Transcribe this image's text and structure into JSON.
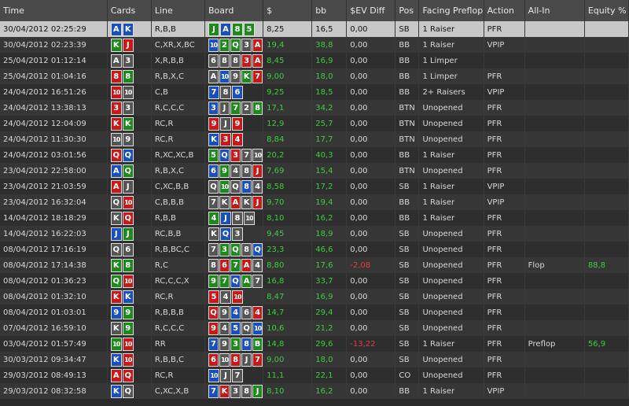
{
  "columns": [
    "Time",
    "Cards",
    "Line",
    "Board",
    "$",
    "bb",
    "$EV Diff",
    "Pos",
    "Facing Preflop",
    "Action",
    "All-In",
    "Equity %"
  ],
  "suit_colors": {
    "s": "#555555",
    "h": "#c81818",
    "d": "#1a4fbf",
    "c": "#1e8a1e"
  },
  "rows": [
    {
      "time": "30/04/2012 02:25:29",
      "cards": [
        [
          "A",
          "d"
        ],
        [
          "K",
          "d"
        ]
      ],
      "line": "R,B,B",
      "board": [
        [
          "J",
          "c"
        ],
        [
          "A",
          "d"
        ],
        [
          "8",
          "c"
        ],
        [
          "5",
          "c"
        ]
      ],
      "dollars": "8,25",
      "bb": "16,5",
      "ev": "0,00",
      "pos": "SB",
      "facing": "1 Raiser",
      "action": "PFR",
      "allin": "",
      "equity": ""
    },
    {
      "time": "30/04/2012 02:23:39",
      "cards": [
        [
          "K",
          "c"
        ],
        [
          "J",
          "h"
        ]
      ],
      "line": "C,XR,X,BC",
      "board": [
        [
          "10",
          "d"
        ],
        [
          "2",
          "c"
        ],
        [
          "Q",
          "c"
        ],
        [
          "3",
          "s"
        ],
        [
          "A",
          "h"
        ]
      ],
      "dollars": "19,4",
      "bb": "38,8",
      "ev": "0,00",
      "pos": "BB",
      "facing": "1 Raiser",
      "action": "VPIP",
      "allin": "",
      "equity": ""
    },
    {
      "time": "25/04/2012 01:12:14",
      "cards": [
        [
          "A",
          "s"
        ],
        [
          "3",
          "s"
        ]
      ],
      "line": "X,R,B,B",
      "board": [
        [
          "6",
          "s"
        ],
        [
          "8",
          "s"
        ],
        [
          "8",
          "s"
        ],
        [
          "3",
          "h"
        ],
        [
          "A",
          "h"
        ]
      ],
      "dollars": "8,45",
      "bb": "16,9",
      "ev": "0,00",
      "pos": "BB",
      "facing": "1 Limper",
      "action": "",
      "allin": "",
      "equity": ""
    },
    {
      "time": "25/04/2012 01:04:16",
      "cards": [
        [
          "8",
          "h"
        ],
        [
          "8",
          "c"
        ]
      ],
      "line": "R,B,X,C",
      "board": [
        [
          "A",
          "s"
        ],
        [
          "10",
          "d"
        ],
        [
          "9",
          "s"
        ],
        [
          "K",
          "c"
        ],
        [
          "7",
          "h"
        ]
      ],
      "dollars": "9,00",
      "bb": "18,0",
      "ev": "0,00",
      "pos": "BB",
      "facing": "1 Limper",
      "action": "PFR",
      "allin": "",
      "equity": ""
    },
    {
      "time": "24/04/2012 16:51:26",
      "cards": [
        [
          "10",
          "h"
        ],
        [
          "10",
          "s"
        ]
      ],
      "line": "C,B",
      "board": [
        [
          "7",
          "d"
        ],
        [
          "8",
          "s"
        ],
        [
          "6",
          "d"
        ]
      ],
      "dollars": "9,25",
      "bb": "18,5",
      "ev": "0,00",
      "pos": "BB",
      "facing": "2+ Raisers",
      "action": "VPIP",
      "allin": "",
      "equity": ""
    },
    {
      "time": "24/04/2012 13:38:13",
      "cards": [
        [
          "3",
          "h"
        ],
        [
          "3",
          "s"
        ]
      ],
      "line": "R,C,C,C",
      "board": [
        [
          "3",
          "d"
        ],
        [
          "J",
          "s"
        ],
        [
          "7",
          "c"
        ],
        [
          "2",
          "s"
        ],
        [
          "8",
          "c"
        ]
      ],
      "dollars": "17,1",
      "bb": "34,2",
      "ev": "0,00",
      "pos": "BTN",
      "facing": "Unopened",
      "action": "PFR",
      "allin": "",
      "equity": ""
    },
    {
      "time": "24/04/2012 12:04:09",
      "cards": [
        [
          "K",
          "h"
        ],
        [
          "K",
          "c"
        ]
      ],
      "line": "RC,R",
      "board": [
        [
          "9",
          "h"
        ],
        [
          "J",
          "s"
        ],
        [
          "9",
          "h"
        ]
      ],
      "dollars": "12,9",
      "bb": "25,7",
      "ev": "0,00",
      "pos": "BTN",
      "facing": "Unopened",
      "action": "PFR",
      "allin": "",
      "equity": ""
    },
    {
      "time": "24/04/2012 11:30:30",
      "cards": [
        [
          "10",
          "s"
        ],
        [
          "9",
          "s"
        ]
      ],
      "line": "RC,R",
      "board": [
        [
          "K",
          "d"
        ],
        [
          "3",
          "h"
        ],
        [
          "4",
          "h"
        ]
      ],
      "dollars": "8,84",
      "bb": "17,7",
      "ev": "0,00",
      "pos": "BTN",
      "facing": "Unopened",
      "action": "PFR",
      "allin": "",
      "equity": ""
    },
    {
      "time": "24/04/2012 03:01:56",
      "cards": [
        [
          "Q",
          "h"
        ],
        [
          "Q",
          "d"
        ]
      ],
      "line": "R,XC,XC,B",
      "board": [
        [
          "5",
          "c"
        ],
        [
          "Q",
          "d"
        ],
        [
          "3",
          "h"
        ],
        [
          "7",
          "s"
        ],
        [
          "10",
          "s"
        ]
      ],
      "dollars": "20,2",
      "bb": "40,3",
      "ev": "0,00",
      "pos": "BB",
      "facing": "1 Raiser",
      "action": "PFR",
      "allin": "",
      "equity": ""
    },
    {
      "time": "23/04/2012 22:58:00",
      "cards": [
        [
          "A",
          "d"
        ],
        [
          "Q",
          "c"
        ]
      ],
      "line": "R,B,X,C",
      "board": [
        [
          "6",
          "d"
        ],
        [
          "9",
          "c"
        ],
        [
          "4",
          "s"
        ],
        [
          "8",
          "s"
        ],
        [
          "J",
          "h"
        ]
      ],
      "dollars": "7,69",
      "bb": "15,4",
      "ev": "0,00",
      "pos": "BTN",
      "facing": "Unopened",
      "action": "PFR",
      "allin": "",
      "equity": ""
    },
    {
      "time": "23/04/2012 21:03:59",
      "cards": [
        [
          "A",
          "h"
        ],
        [
          "J",
          "s"
        ]
      ],
      "line": "C,XC,B,B",
      "board": [
        [
          "Q",
          "s"
        ],
        [
          "10",
          "c"
        ],
        [
          "Q",
          "s"
        ],
        [
          "8",
          "d"
        ],
        [
          "4",
          "s"
        ]
      ],
      "dollars": "8,58",
      "bb": "17,2",
      "ev": "0,00",
      "pos": "SB",
      "facing": "1 Raiser",
      "action": "VPIP",
      "allin": "",
      "equity": ""
    },
    {
      "time": "23/04/2012 16:32:04",
      "cards": [
        [
          "Q",
          "s"
        ],
        [
          "10",
          "h"
        ]
      ],
      "line": "C,B,B,B",
      "board": [
        [
          "7",
          "s"
        ],
        [
          "K",
          "s"
        ],
        [
          "A",
          "h"
        ],
        [
          "K",
          "s"
        ],
        [
          "J",
          "h"
        ]
      ],
      "dollars": "9,70",
      "bb": "19,4",
      "ev": "0,00",
      "pos": "BB",
      "facing": "1 Raiser",
      "action": "VPIP",
      "allin": "",
      "equity": ""
    },
    {
      "time": "14/04/2012 18:18:29",
      "cards": [
        [
          "K",
          "s"
        ],
        [
          "Q",
          "h"
        ]
      ],
      "line": "R,B,B",
      "board": [
        [
          "4",
          "c"
        ],
        [
          "J",
          "d"
        ],
        [
          "8",
          "s"
        ],
        [
          "10",
          "s"
        ]
      ],
      "dollars": "8,10",
      "bb": "16,2",
      "ev": "0,00",
      "pos": "BB",
      "facing": "1 Raiser",
      "action": "PFR",
      "allin": "",
      "equity": ""
    },
    {
      "time": "14/04/2012 16:22:03",
      "cards": [
        [
          "J",
          "d"
        ],
        [
          "J",
          "c"
        ]
      ],
      "line": "RC,B,B",
      "board": [
        [
          "K",
          "s"
        ],
        [
          "Q",
          "d"
        ],
        [
          "3",
          "s"
        ]
      ],
      "dollars": "9,45",
      "bb": "18,9",
      "ev": "0,00",
      "pos": "SB",
      "facing": "Unopened",
      "action": "PFR",
      "allin": "",
      "equity": ""
    },
    {
      "time": "08/04/2012 17:16:19",
      "cards": [
        [
          "Q",
          "s"
        ],
        [
          "6",
          "s"
        ]
      ],
      "line": "R,B,BC,C",
      "board": [
        [
          "7",
          "s"
        ],
        [
          "3",
          "c"
        ],
        [
          "Q",
          "c"
        ],
        [
          "8",
          "s"
        ],
        [
          "Q",
          "d"
        ]
      ],
      "dollars": "23,3",
      "bb": "46,6",
      "ev": "0,00",
      "pos": "SB",
      "facing": "Unopened",
      "action": "PFR",
      "allin": "",
      "equity": ""
    },
    {
      "time": "08/04/2012 17:14:38",
      "cards": [
        [
          "K",
          "c"
        ],
        [
          "8",
          "c"
        ]
      ],
      "line": "R,C",
      "board": [
        [
          "8",
          "s"
        ],
        [
          "6",
          "h"
        ],
        [
          "7",
          "c"
        ],
        [
          "A",
          "h"
        ],
        [
          "4",
          "s"
        ]
      ],
      "dollars": "8,80",
      "bb": "17,6",
      "ev": "-2,08",
      "pos": "SB",
      "facing": "Unopened",
      "action": "PFR",
      "allin": "Flop",
      "equity": "88,8"
    },
    {
      "time": "08/04/2012 01:36:23",
      "cards": [
        [
          "Q",
          "c"
        ],
        [
          "10",
          "h"
        ]
      ],
      "line": "RC,C,C,X",
      "board": [
        [
          "9",
          "c"
        ],
        [
          "7",
          "c"
        ],
        [
          "Q",
          "d"
        ],
        [
          "A",
          "c"
        ],
        [
          "7",
          "s"
        ]
      ],
      "dollars": "16,8",
      "bb": "33,7",
      "ev": "0,00",
      "pos": "SB",
      "facing": "Unopened",
      "action": "PFR",
      "allin": "",
      "equity": ""
    },
    {
      "time": "08/04/2012 01:32:10",
      "cards": [
        [
          "K",
          "h"
        ],
        [
          "K",
          "d"
        ]
      ],
      "line": "RC,R",
      "board": [
        [
          "5",
          "h"
        ],
        [
          "4",
          "s"
        ],
        [
          "10",
          "h"
        ]
      ],
      "dollars": "8,47",
      "bb": "16,9",
      "ev": "0,00",
      "pos": "SB",
      "facing": "Unopened",
      "action": "PFR",
      "allin": "",
      "equity": ""
    },
    {
      "time": "08/04/2012 01:03:01",
      "cards": [
        [
          "9",
          "d"
        ],
        [
          "9",
          "c"
        ]
      ],
      "line": "R,B,B,B",
      "board": [
        [
          "Q",
          "h"
        ],
        [
          "9",
          "s"
        ],
        [
          "4",
          "d"
        ],
        [
          "6",
          "s"
        ],
        [
          "4",
          "h"
        ]
      ],
      "dollars": "14,7",
      "bb": "29,4",
      "ev": "0,00",
      "pos": "SB",
      "facing": "Unopened",
      "action": "PFR",
      "allin": "",
      "equity": ""
    },
    {
      "time": "07/04/2012 16:59:10",
      "cards": [
        [
          "K",
          "s"
        ],
        [
          "9",
          "c"
        ]
      ],
      "line": "R,C,C,C",
      "board": [
        [
          "9",
          "h"
        ],
        [
          "4",
          "s"
        ],
        [
          "5",
          "d"
        ],
        [
          "Q",
          "s"
        ],
        [
          "10",
          "d"
        ]
      ],
      "dollars": "10,6",
      "bb": "21,2",
      "ev": "0,00",
      "pos": "SB",
      "facing": "Unopened",
      "action": "PFR",
      "allin": "",
      "equity": ""
    },
    {
      "time": "03/04/2012 01:57:49",
      "cards": [
        [
          "10",
          "c"
        ],
        [
          "10",
          "h"
        ]
      ],
      "line": "RR",
      "board": [
        [
          "7",
          "d"
        ],
        [
          "9",
          "s"
        ],
        [
          "3",
          "c"
        ],
        [
          "8",
          "d"
        ],
        [
          "B",
          "c"
        ]
      ],
      "dollars": "14,8",
      "bb": "29,6",
      "ev": "-13,22",
      "pos": "SB",
      "facing": "1 Raiser",
      "action": "PFR",
      "allin": "Preflop",
      "equity": "56,9"
    },
    {
      "time": "30/03/2012 09:34:47",
      "cards": [
        [
          "K",
          "d"
        ],
        [
          "10",
          "h"
        ]
      ],
      "line": "R,B,B,C",
      "board": [
        [
          "6",
          "h"
        ],
        [
          "10",
          "s"
        ],
        [
          "8",
          "h"
        ],
        [
          "J",
          "s"
        ],
        [
          "7",
          "h"
        ]
      ],
      "dollars": "9,00",
      "bb": "18,0",
      "ev": "0,00",
      "pos": "SB",
      "facing": "Unopened",
      "action": "PFR",
      "allin": "",
      "equity": ""
    },
    {
      "time": "29/03/2012 08:49:13",
      "cards": [
        [
          "A",
          "h"
        ],
        [
          "Q",
          "h"
        ]
      ],
      "line": "RC,R",
      "board": [
        [
          "10",
          "d"
        ],
        [
          "J",
          "s"
        ],
        [
          "7",
          "s"
        ]
      ],
      "dollars": "11,1",
      "bb": "22,1",
      "ev": "0,00",
      "pos": "CO",
      "facing": "Unopened",
      "action": "PFR",
      "allin": "",
      "equity": ""
    },
    {
      "time": "29/03/2012 08:32:58",
      "cards": [
        [
          "K",
          "d"
        ],
        [
          "Q",
          "s"
        ]
      ],
      "line": "C,XC,X,B",
      "board": [
        [
          "7",
          "d"
        ],
        [
          "K",
          "h"
        ],
        [
          "3",
          "s"
        ],
        [
          "8",
          "s"
        ],
        [
          "J",
          "c"
        ]
      ],
      "dollars": "8,10",
      "bb": "16,2",
      "ev": "0,00",
      "pos": "BB",
      "facing": "1 Raiser",
      "action": "VPIP",
      "allin": "",
      "equity": ""
    }
  ]
}
